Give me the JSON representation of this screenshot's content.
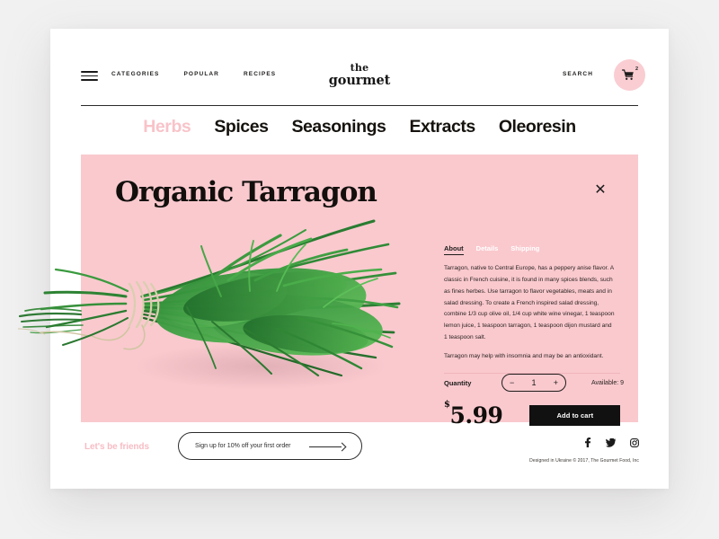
{
  "theme": {
    "pink_panel": "#f9c9ce",
    "pink_accent": "#f8c3c9",
    "dark": "#111111",
    "card_bg": "#ffffff",
    "page_bg": "#f1f1f1"
  },
  "header": {
    "menu_icon": "hamburger-icon",
    "nav": [
      {
        "label": "CATEGORIES"
      },
      {
        "label": "POPULAR"
      },
      {
        "label": "RECIPES"
      }
    ],
    "logo": {
      "line1": "the",
      "line2": "gourmet"
    },
    "search_label": "SEARCH",
    "cart": {
      "icon": "shopping-cart-icon",
      "count": "2"
    }
  },
  "categories": [
    {
      "label": "Herbs",
      "active": true
    },
    {
      "label": "Spices",
      "active": false
    },
    {
      "label": "Seasonings",
      "active": false
    },
    {
      "label": "Extracts",
      "active": false
    },
    {
      "label": "Oleoresin",
      "active": false
    }
  ],
  "product": {
    "title": "Organic Tarragon",
    "close_icon": "close-icon",
    "image_alt": "organic-tarragon-bunch",
    "tabs": [
      {
        "label": "About",
        "active": true
      },
      {
        "label": "Details",
        "active": false
      },
      {
        "label": "Shipping",
        "active": false
      }
    ],
    "description": "Tarragon, native to Central Europe, has a peppery anise flavor. A classic in French cuisine, it is found in many spices blends, such as fines herbes. Use tarragon to flavor vegetables, meats and in salad dressing. To create a French inspired salad dressing, combine 1/3 cup olive oil, 1/4 cup white wine vinegar, 1 teaspoon lemon juice, 1 teaspoon tarragon, 1 teaspoon dijon mustard and 1 teaspoon salt.",
    "description_note": "Tarragon may help with insomnia and may be an antioxidant.",
    "quantity_label": "Quantity",
    "quantity_value": "1",
    "decrement_label": "−",
    "increment_label": "+",
    "availability": "Available: 9",
    "currency": "$",
    "price": "5.99",
    "add_to_cart_label": "Add to cart"
  },
  "footer": {
    "newsletter_heading": "Let's be friends",
    "newsletter_placeholder": "Sign up for 10% off your first order",
    "submit_icon": "arrow-right-icon",
    "social": [
      {
        "name": "facebook-icon",
        "glyph": "f"
      },
      {
        "name": "twitter-icon",
        "glyph": "✈"
      },
      {
        "name": "instagram-icon",
        "glyph": "◎"
      }
    ],
    "copyright": "Designed in Ukraine © 2017, The Gourmet Food, Inc"
  }
}
